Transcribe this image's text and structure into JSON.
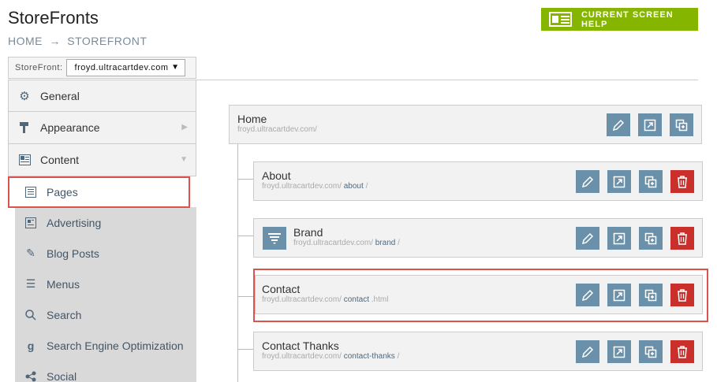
{
  "app": {
    "title": "StoreFronts"
  },
  "breadcrumb": {
    "home": "HOME",
    "sep": "→",
    "current": "STOREFRONT"
  },
  "help": {
    "label": "CURRENT SCREEN HELP"
  },
  "storefront": {
    "label": "StoreFront:",
    "selected": "froyd.ultracartdev.com"
  },
  "nav": {
    "items": [
      {
        "label": "General",
        "icon": "gear-icon"
      },
      {
        "label": "Appearance",
        "icon": "paint-roller-icon"
      },
      {
        "label": "Content",
        "icon": "content-icon"
      }
    ],
    "sub": [
      {
        "label": "Pages",
        "icon": "pages-icon"
      },
      {
        "label": "Advertising",
        "icon": "advertising-icon"
      },
      {
        "label": "Blog Posts",
        "icon": "blog-icon"
      },
      {
        "label": "Menus",
        "icon": "menu-icon"
      },
      {
        "label": "Search",
        "icon": "search-icon"
      },
      {
        "label": "Search Engine Optimization",
        "icon": "seo-icon"
      },
      {
        "label": "Social",
        "icon": "social-icon"
      }
    ]
  },
  "pages": [
    {
      "title": "Home",
      "url_base": "froyd.ultracartdev.com/",
      "slug": "",
      "suffix": ""
    },
    {
      "title": "About",
      "url_base": "froyd.ultracartdev.com/",
      "slug": "about",
      "suffix": "/"
    },
    {
      "title": "Brand",
      "url_base": "froyd.ultracartdev.com/",
      "slug": "brand",
      "suffix": "/"
    },
    {
      "title": "Contact",
      "url_base": "froyd.ultracartdev.com/",
      "slug": "contact",
      "suffix": ".html"
    },
    {
      "title": "Contact Thanks",
      "url_base": "froyd.ultracartdev.com/",
      "slug": "contact-thanks",
      "suffix": "/"
    }
  ],
  "colors": {
    "accent_green": "#86b500",
    "action_blue": "#6a90aa",
    "delete_red": "#c9302c",
    "highlight": "#d9534f"
  }
}
